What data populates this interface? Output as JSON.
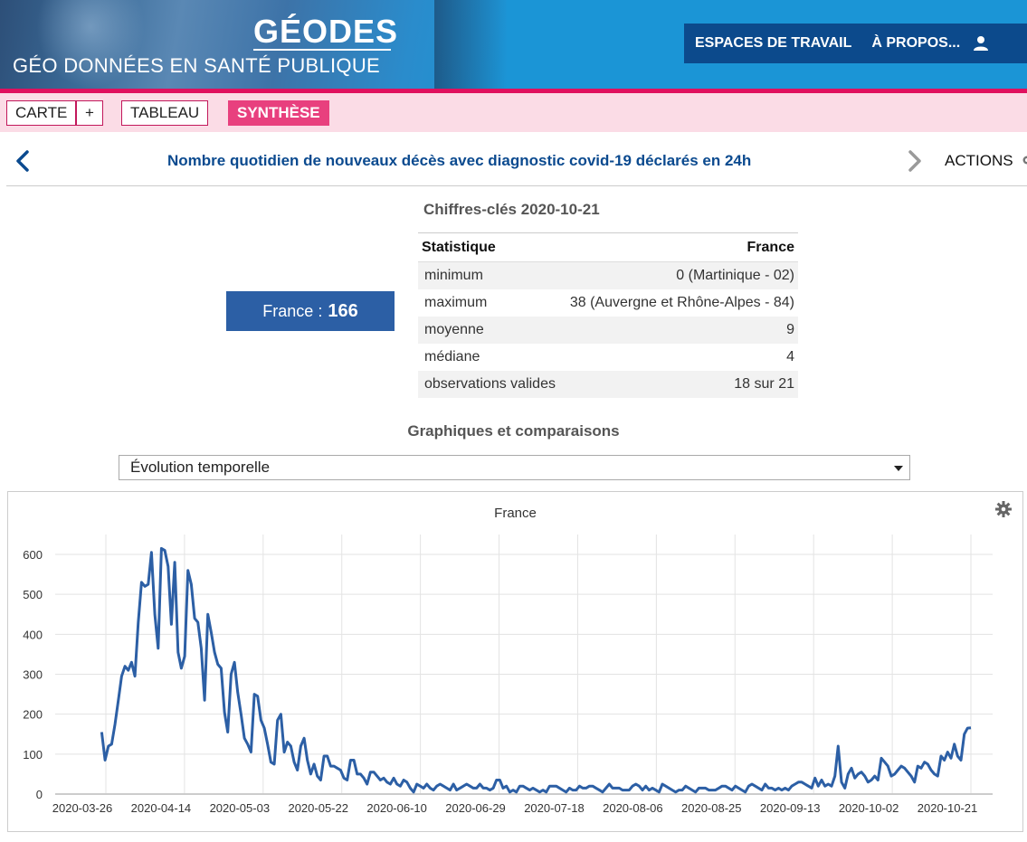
{
  "header": {
    "logo_title": "GÉODES",
    "logo_subtitle": "GÉO DONNÉES EN SANTÉ PUBLIQUE",
    "nav": [
      "ESPACES DE TRAVAIL",
      "À PROPOS..."
    ],
    "user_icon": "user-icon"
  },
  "tabs": {
    "carte": "CARTE",
    "plus": "+",
    "tableau": "TABLEAU",
    "synthese": "SYNTHÈSE",
    "active": "SYNTHÈSE"
  },
  "indicator": {
    "title": "Nombre quotidien de nouveaux décès avec diagnostic covid-19 déclarés en 24h",
    "actions_label": "ACTIONS"
  },
  "key_figures": {
    "title": "Chiffres-clés 2020-10-21",
    "col_stat": "Statistique",
    "col_area": "France",
    "rows": [
      {
        "label": "minimum",
        "value": "0 (Martinique - 02)"
      },
      {
        "label": "maximum",
        "value": "38 (Auvergne et Rhône-Alpes - 84)"
      },
      {
        "label": "moyenne",
        "value": "9"
      },
      {
        "label": "médiane",
        "value": "4"
      },
      {
        "label": "observations valides",
        "value": "18 sur 21"
      }
    ],
    "france_label": "France :",
    "france_value": "166"
  },
  "charts_section": {
    "title": "Graphiques et comparaisons",
    "selected": "Évolution temporelle"
  },
  "colors": {
    "header_blue": "#1b95d6",
    "nav_dark": "#0c4a8c",
    "accent_pink": "#e0105e",
    "series": "#2c5fa5"
  },
  "chart_data": {
    "type": "line",
    "title": "France",
    "xlabel": "",
    "ylabel": "",
    "ylim": [
      0,
      600
    ],
    "yticks": [
      0,
      100,
      200,
      300,
      400,
      500,
      600
    ],
    "xticks": [
      "2020-03-26",
      "2020-04-14",
      "2020-05-03",
      "2020-05-22",
      "2020-06-10",
      "2020-06-29",
      "2020-07-18",
      "2020-08-06",
      "2020-08-25",
      "2020-09-13",
      "2020-10-02",
      "2020-10-21"
    ],
    "grid": true,
    "series": [
      {
        "x_start": "2020-03-25",
        "x_end": "2020-10-21",
        "values": [
          155,
          85,
          120,
          125,
          175,
          235,
          295,
          320,
          310,
          330,
          295,
          430,
          530,
          520,
          525,
          605,
          450,
          365,
          615,
          610,
          570,
          425,
          580,
          355,
          315,
          345,
          560,
          525,
          440,
          430,
          365,
          235,
          450,
          405,
          355,
          325,
          315,
          205,
          155,
          300,
          330,
          255,
          200,
          140,
          125,
          105,
          250,
          245,
          185,
          165,
          125,
          80,
          75,
          185,
          200,
          105,
          130,
          120,
          80,
          60,
          120,
          140,
          85,
          50,
          75,
          45,
          35,
          95,
          95,
          70,
          70,
          65,
          60,
          40,
          35,
          85,
          85,
          50,
          50,
          40,
          25,
          55,
          55,
          45,
          35,
          40,
          30,
          25,
          40,
          25,
          20,
          35,
          30,
          15,
          5,
          25,
          20,
          15,
          25,
          15,
          10,
          20,
          25,
          20,
          15,
          10,
          25,
          10,
          15,
          20,
          25,
          20,
          15,
          15,
          25,
          15,
          15,
          10,
          15,
          35,
          35,
          15,
          20,
          5,
          10,
          5,
          20,
          20,
          15,
          10,
          15,
          10,
          5,
          10,
          5,
          20,
          20,
          20,
          15,
          10,
          5,
          15,
          10,
          10,
          20,
          15,
          15,
          20,
          20,
          15,
          10,
          5,
          15,
          25,
          15,
          15,
          15,
          10,
          10,
          10,
          20,
          25,
          20,
          10,
          20,
          10,
          15,
          10,
          5,
          25,
          20,
          15,
          10,
          5,
          10,
          10,
          20,
          15,
          10,
          5,
          15,
          15,
          15,
          10,
          10,
          10,
          15,
          20,
          20,
          15,
          10,
          20,
          15,
          10,
          5,
          20,
          25,
          20,
          15,
          10,
          25,
          15,
          15,
          10,
          15,
          10,
          15,
          10,
          20,
          25,
          30,
          30,
          25,
          20,
          15,
          40,
          20,
          35,
          20,
          25,
          20,
          45,
          120,
          30,
          15,
          50,
          65,
          40,
          50,
          55,
          45,
          30,
          35,
          45,
          35,
          90,
          80,
          70,
          45,
          50,
          60,
          70,
          65,
          55,
          45,
          30,
          70,
          65,
          80,
          75,
          60,
          50,
          45,
          95,
          85,
          105,
          90,
          125,
          95,
          85,
          150,
          165,
          166
        ]
      }
    ]
  }
}
